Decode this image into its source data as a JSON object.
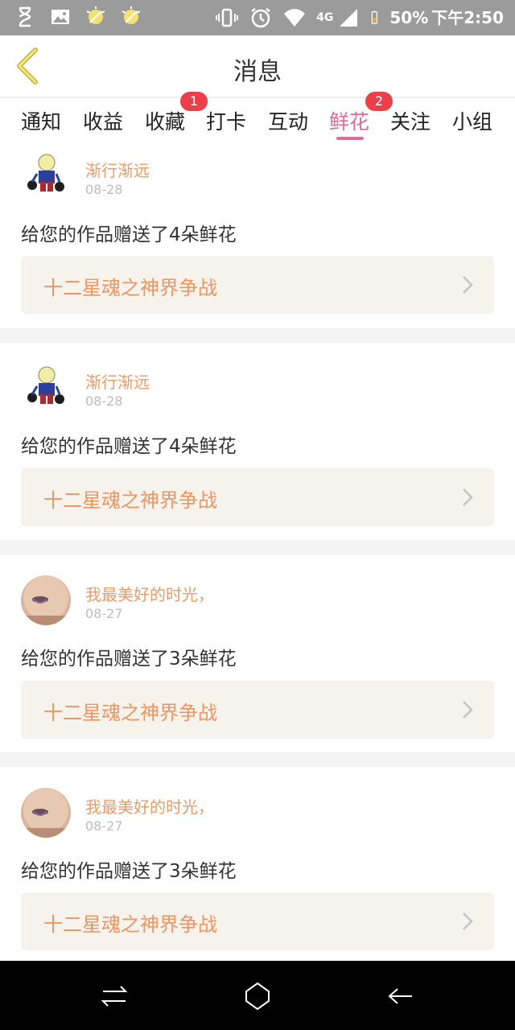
{
  "status_bar": {
    "network": "4G",
    "battery": "50%",
    "time": "下午2:50",
    "icons": [
      "hourglass-icon",
      "image-icon",
      "bulb-icon",
      "bulb-icon",
      "vibrate-icon",
      "alarm-icon",
      "wifi-icon",
      "signal-icon",
      "battery-icon"
    ]
  },
  "header": {
    "title": "消息",
    "back_icon": "chevron-left-icon"
  },
  "tabs": [
    {
      "label": "通知"
    },
    {
      "label": "收益"
    },
    {
      "label": "收藏",
      "badge": "1"
    },
    {
      "label": "打卡"
    },
    {
      "label": "互动"
    },
    {
      "label": "鲜花",
      "badge": "2",
      "active": true
    },
    {
      "label": "关注"
    },
    {
      "label": "小组"
    }
  ],
  "items": [
    {
      "user": "渐行渐远",
      "date": "08-28",
      "message": "给您的作品赠送了4朵鲜花",
      "work_title": "十二星魂之神界争战"
    },
    {
      "user": "渐行渐远",
      "date": "08-28",
      "message": "给您的作品赠送了4朵鲜花",
      "work_title": "十二星魂之神界争战"
    },
    {
      "user": "我最美好的时光，",
      "date": "08-27",
      "message": "给您的作品赠送了3朵鲜花",
      "work_title": "十二星魂之神界争战"
    },
    {
      "user": "我最美好的时光，",
      "date": "08-27",
      "message": "给您的作品赠送了3朵鲜花",
      "work_title": "十二星魂之神界争战"
    }
  ],
  "colors": {
    "accent": "#e26b93",
    "username": "#eb9b68",
    "work_title": "#ef9561",
    "badge": "#ec3f4a"
  }
}
